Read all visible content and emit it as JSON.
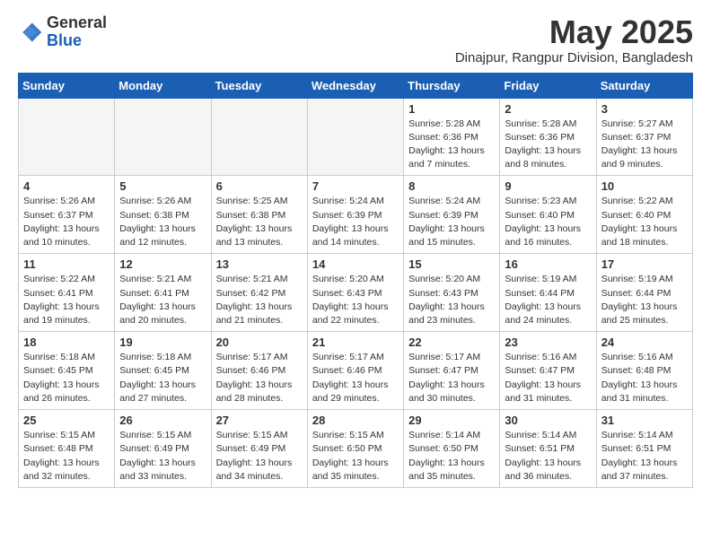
{
  "header": {
    "logo_general": "General",
    "logo_blue": "Blue",
    "month": "May 2025",
    "location": "Dinajpur, Rangpur Division, Bangladesh"
  },
  "days_of_week": [
    "Sunday",
    "Monday",
    "Tuesday",
    "Wednesday",
    "Thursday",
    "Friday",
    "Saturday"
  ],
  "weeks": [
    [
      {
        "day": "",
        "info": ""
      },
      {
        "day": "",
        "info": ""
      },
      {
        "day": "",
        "info": ""
      },
      {
        "day": "",
        "info": ""
      },
      {
        "day": "1",
        "info": "Sunrise: 5:28 AM\nSunset: 6:36 PM\nDaylight: 13 hours and 7 minutes."
      },
      {
        "day": "2",
        "info": "Sunrise: 5:28 AM\nSunset: 6:36 PM\nDaylight: 13 hours and 8 minutes."
      },
      {
        "day": "3",
        "info": "Sunrise: 5:27 AM\nSunset: 6:37 PM\nDaylight: 13 hours and 9 minutes."
      }
    ],
    [
      {
        "day": "4",
        "info": "Sunrise: 5:26 AM\nSunset: 6:37 PM\nDaylight: 13 hours and 10 minutes."
      },
      {
        "day": "5",
        "info": "Sunrise: 5:26 AM\nSunset: 6:38 PM\nDaylight: 13 hours and 12 minutes."
      },
      {
        "day": "6",
        "info": "Sunrise: 5:25 AM\nSunset: 6:38 PM\nDaylight: 13 hours and 13 minutes."
      },
      {
        "day": "7",
        "info": "Sunrise: 5:24 AM\nSunset: 6:39 PM\nDaylight: 13 hours and 14 minutes."
      },
      {
        "day": "8",
        "info": "Sunrise: 5:24 AM\nSunset: 6:39 PM\nDaylight: 13 hours and 15 minutes."
      },
      {
        "day": "9",
        "info": "Sunrise: 5:23 AM\nSunset: 6:40 PM\nDaylight: 13 hours and 16 minutes."
      },
      {
        "day": "10",
        "info": "Sunrise: 5:22 AM\nSunset: 6:40 PM\nDaylight: 13 hours and 18 minutes."
      }
    ],
    [
      {
        "day": "11",
        "info": "Sunrise: 5:22 AM\nSunset: 6:41 PM\nDaylight: 13 hours and 19 minutes."
      },
      {
        "day": "12",
        "info": "Sunrise: 5:21 AM\nSunset: 6:41 PM\nDaylight: 13 hours and 20 minutes."
      },
      {
        "day": "13",
        "info": "Sunrise: 5:21 AM\nSunset: 6:42 PM\nDaylight: 13 hours and 21 minutes."
      },
      {
        "day": "14",
        "info": "Sunrise: 5:20 AM\nSunset: 6:43 PM\nDaylight: 13 hours and 22 minutes."
      },
      {
        "day": "15",
        "info": "Sunrise: 5:20 AM\nSunset: 6:43 PM\nDaylight: 13 hours and 23 minutes."
      },
      {
        "day": "16",
        "info": "Sunrise: 5:19 AM\nSunset: 6:44 PM\nDaylight: 13 hours and 24 minutes."
      },
      {
        "day": "17",
        "info": "Sunrise: 5:19 AM\nSunset: 6:44 PM\nDaylight: 13 hours and 25 minutes."
      }
    ],
    [
      {
        "day": "18",
        "info": "Sunrise: 5:18 AM\nSunset: 6:45 PM\nDaylight: 13 hours and 26 minutes."
      },
      {
        "day": "19",
        "info": "Sunrise: 5:18 AM\nSunset: 6:45 PM\nDaylight: 13 hours and 27 minutes."
      },
      {
        "day": "20",
        "info": "Sunrise: 5:17 AM\nSunset: 6:46 PM\nDaylight: 13 hours and 28 minutes."
      },
      {
        "day": "21",
        "info": "Sunrise: 5:17 AM\nSunset: 6:46 PM\nDaylight: 13 hours and 29 minutes."
      },
      {
        "day": "22",
        "info": "Sunrise: 5:17 AM\nSunset: 6:47 PM\nDaylight: 13 hours and 30 minutes."
      },
      {
        "day": "23",
        "info": "Sunrise: 5:16 AM\nSunset: 6:47 PM\nDaylight: 13 hours and 31 minutes."
      },
      {
        "day": "24",
        "info": "Sunrise: 5:16 AM\nSunset: 6:48 PM\nDaylight: 13 hours and 31 minutes."
      }
    ],
    [
      {
        "day": "25",
        "info": "Sunrise: 5:15 AM\nSunset: 6:48 PM\nDaylight: 13 hours and 32 minutes."
      },
      {
        "day": "26",
        "info": "Sunrise: 5:15 AM\nSunset: 6:49 PM\nDaylight: 13 hours and 33 minutes."
      },
      {
        "day": "27",
        "info": "Sunrise: 5:15 AM\nSunset: 6:49 PM\nDaylight: 13 hours and 34 minutes."
      },
      {
        "day": "28",
        "info": "Sunrise: 5:15 AM\nSunset: 6:50 PM\nDaylight: 13 hours and 35 minutes."
      },
      {
        "day": "29",
        "info": "Sunrise: 5:14 AM\nSunset: 6:50 PM\nDaylight: 13 hours and 35 minutes."
      },
      {
        "day": "30",
        "info": "Sunrise: 5:14 AM\nSunset: 6:51 PM\nDaylight: 13 hours and 36 minutes."
      },
      {
        "day": "31",
        "info": "Sunrise: 5:14 AM\nSunset: 6:51 PM\nDaylight: 13 hours and 37 minutes."
      }
    ]
  ]
}
